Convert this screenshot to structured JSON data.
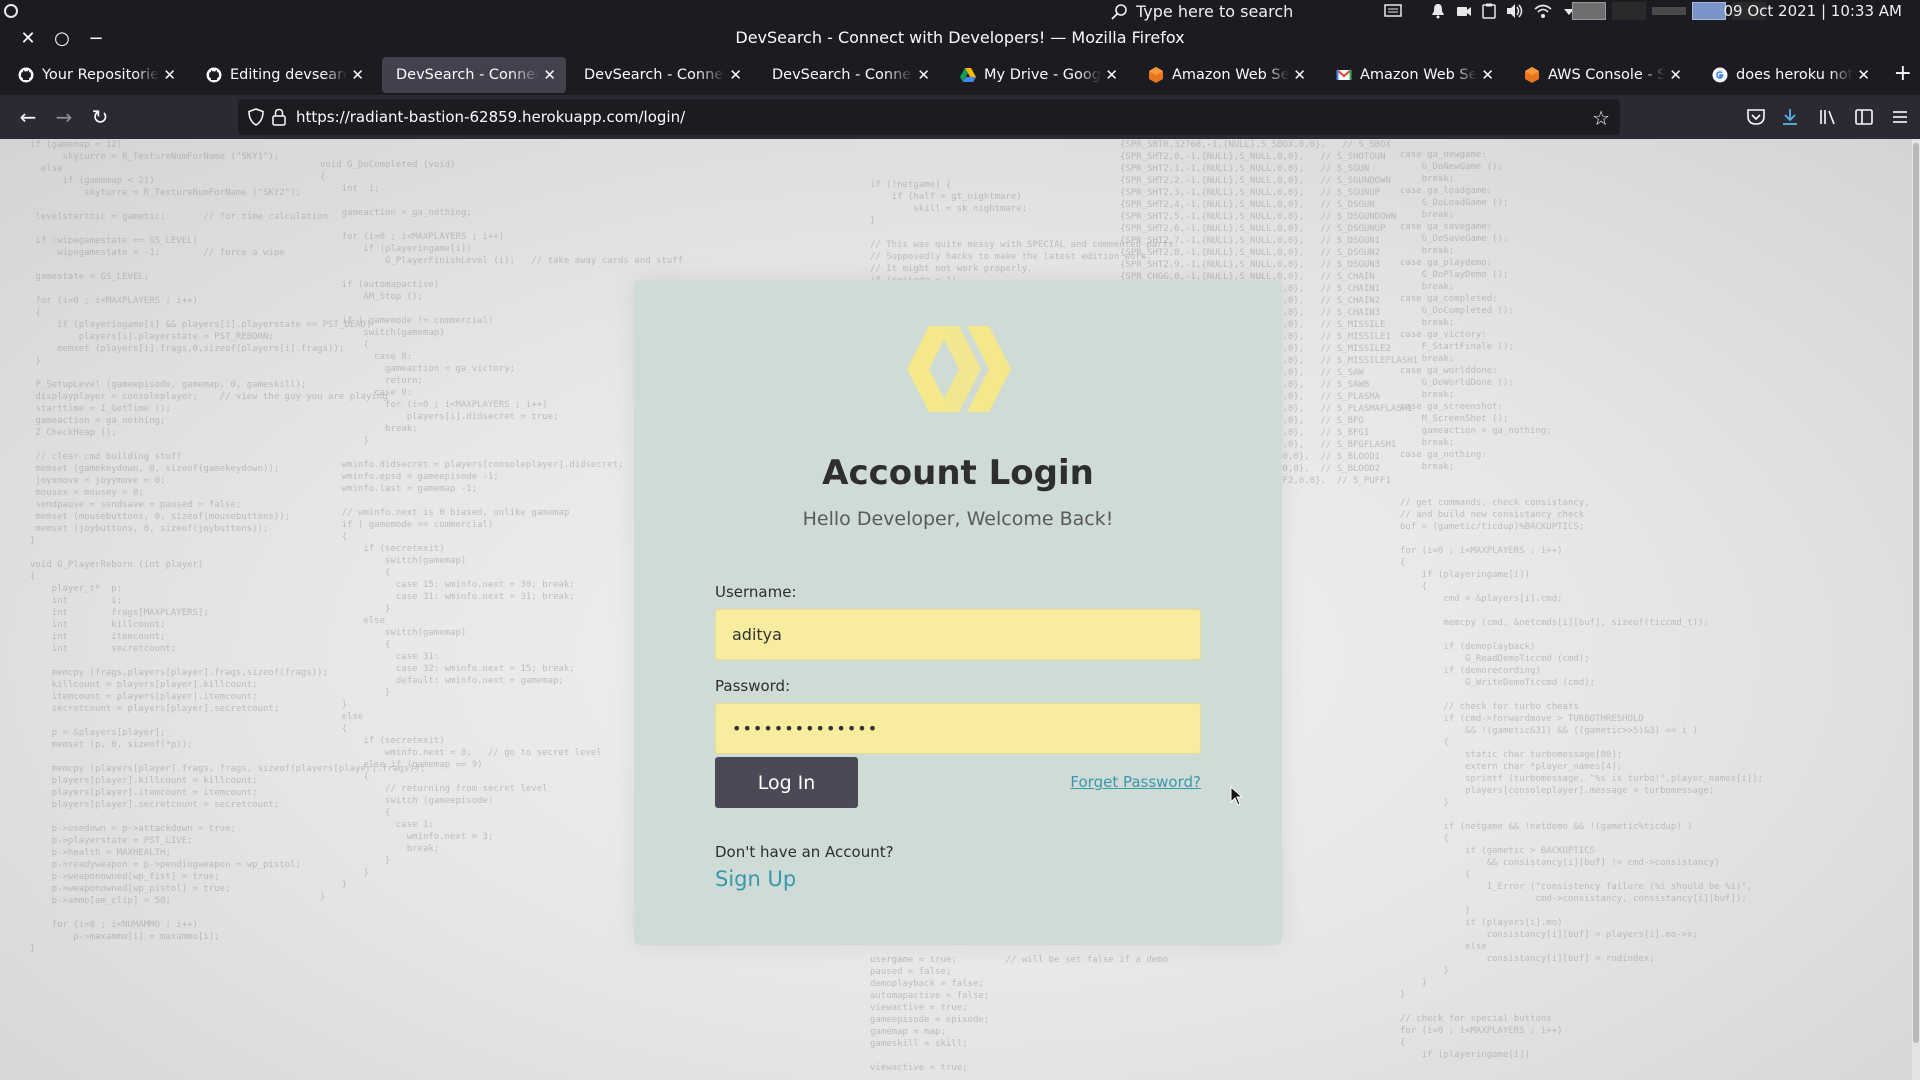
{
  "system": {
    "search_placeholder": "Type here to search",
    "clock": "09 Oct 2021 | 10:33 AM"
  },
  "window": {
    "title": "DevSearch - Connect with Developers! — Mozilla Firefox"
  },
  "tabs": [
    {
      "label": "Your Repositories",
      "favicon": "github-icon",
      "active": false
    },
    {
      "label": "Editing devsearch/README",
      "favicon": "github-icon",
      "active": false
    },
    {
      "label": "DevSearch - Connect with Developers!",
      "favicon": "none",
      "active": true
    },
    {
      "label": "DevSearch - Connect with Developers!",
      "favicon": "none",
      "active": false
    },
    {
      "label": "DevSearch - Connect with Developers!",
      "favicon": "none",
      "active": false
    },
    {
      "label": "My Drive - Google Drive",
      "favicon": "google-drive-icon",
      "active": false
    },
    {
      "label": "Amazon Web Services",
      "favicon": "aws-icon",
      "active": false
    },
    {
      "label": "Amazon Web Services",
      "favicon": "gmail-icon",
      "active": false
    },
    {
      "label": "AWS Console - Signup",
      "favicon": "aws-icon",
      "active": false
    },
    {
      "label": "does heroku not allow",
      "favicon": "google-icon",
      "active": false
    }
  ],
  "navbar": {
    "url": "https://radiant-bastion-62859.herokuapp.com/login/"
  },
  "login": {
    "title": "Account Login",
    "subtitle": "Hello Developer, Welcome Back!",
    "username_label": "Username:",
    "username_value": "aditya",
    "password_label": "Password:",
    "password_value": "••••••••••••••",
    "login_button": "Log In",
    "forgot_link": "Forget Password?",
    "no_account_text": "Don't have an Account?",
    "signup_link": "Sign Up"
  },
  "colors": {
    "accent_link": "#3a98ae",
    "input_bg": "#f8ec9f",
    "card_bg": "#cfdbd5",
    "button_bg": "#4a4958",
    "logo": "#f5e88a"
  }
}
